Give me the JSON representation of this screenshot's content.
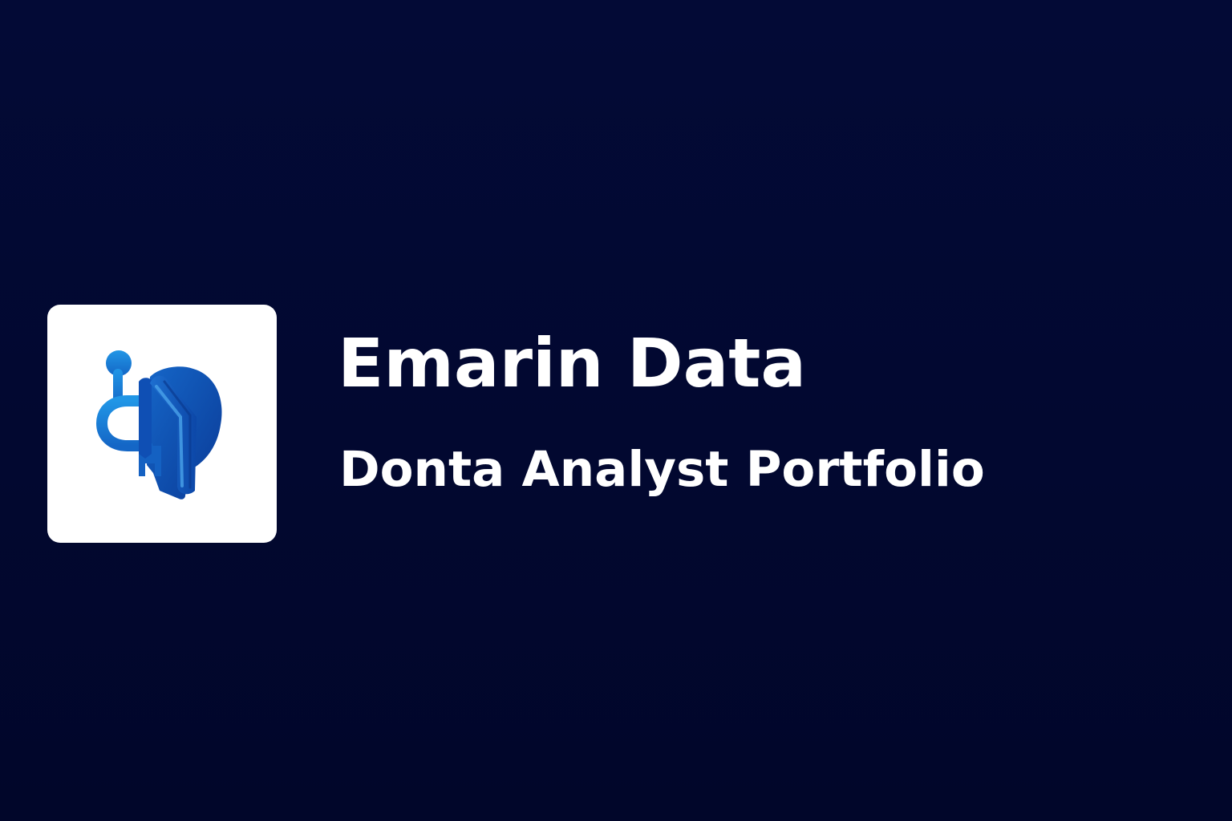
{
  "brand": {
    "name": "Emarin Data",
    "tagline": "Donta Analyst Portfolio",
    "logo_icon": "abstract-blue-figure-icon",
    "colors": {
      "background": "#020830",
      "tile": "#ffffff",
      "logo_light_blue": "#1f8ae0",
      "logo_dark_blue": "#0b3f9e",
      "text": "#ffffff"
    }
  }
}
